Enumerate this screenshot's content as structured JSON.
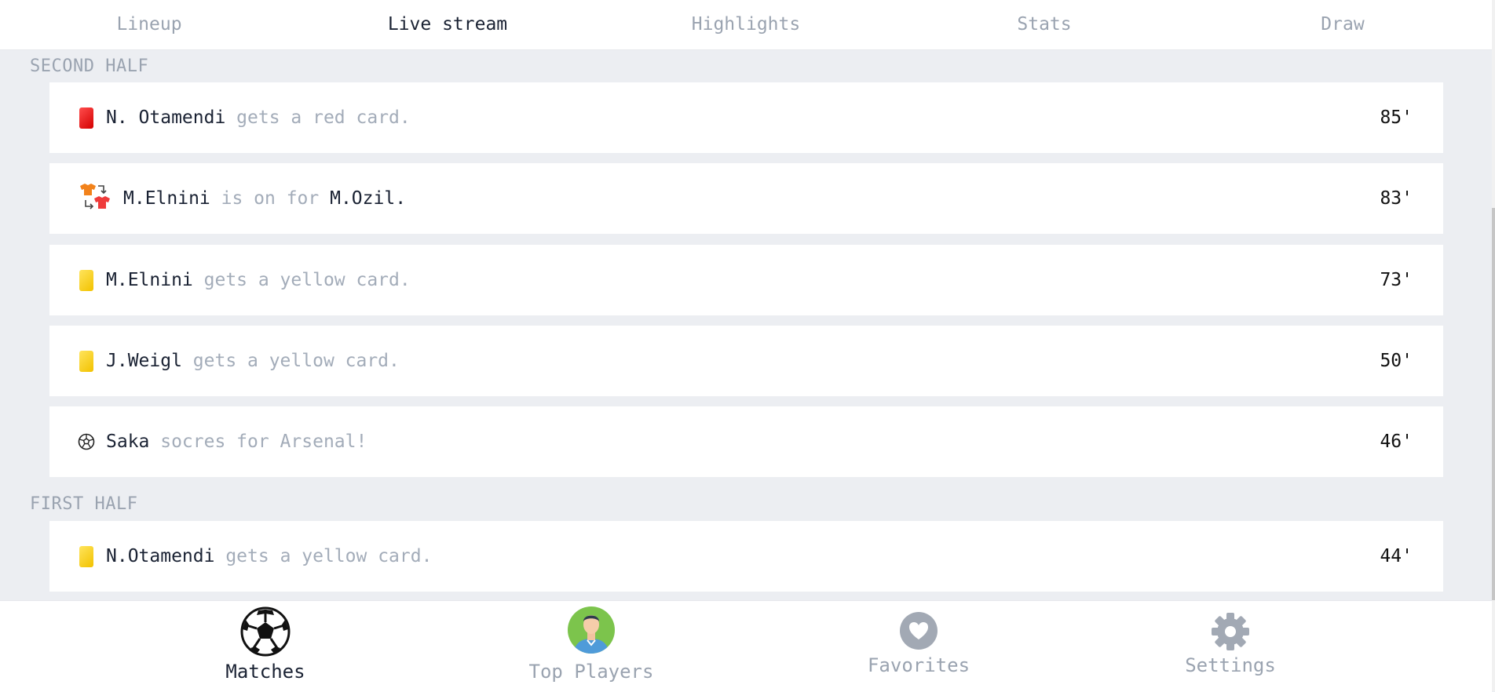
{
  "tabs": [
    {
      "label": "Lineup"
    },
    {
      "label": "Live stream",
      "active": true
    },
    {
      "label": "Highlights"
    },
    {
      "label": "Stats"
    },
    {
      "label": "Draw"
    }
  ],
  "sections": {
    "second_half": "SECOND HALF",
    "first_half": "FIRST HALF"
  },
  "events": [
    {
      "type": "red-card",
      "player": "N. Otamendi",
      "desc": " gets a red card.",
      "minute": "85'"
    },
    {
      "type": "substitution",
      "player": "M.Elnini",
      "desc": " is on for ",
      "player2": "M.Ozil.",
      "minute": "83'"
    },
    {
      "type": "yellow-card",
      "player": "M.Elnini",
      "desc": " gets a yellow card.",
      "minute": "73'"
    },
    {
      "type": "yellow-card",
      "player": "J.Weigl",
      "desc": " gets a yellow card.",
      "minute": "50'"
    },
    {
      "type": "goal",
      "player": "Saka",
      "desc": " socres for Arsenal!",
      "minute": "46'"
    },
    {
      "type": "yellow-card",
      "player": "N.Otamendi",
      "desc": " gets a yellow card.",
      "minute": "44'"
    }
  ],
  "bottom_nav": {
    "matches": "Matches",
    "top_players": "Top Players",
    "favorites": "Favorites",
    "settings": "Settings"
  },
  "colors": {
    "accent_text": "#1a2233",
    "muted_text": "#9aa3b0",
    "background": "#eceef2"
  }
}
